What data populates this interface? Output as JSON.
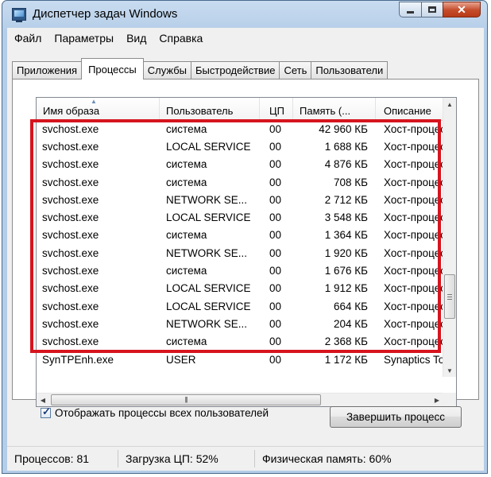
{
  "window": {
    "title": "Диспетчер задач Windows"
  },
  "menu": [
    "Файл",
    "Параметры",
    "Вид",
    "Справка"
  ],
  "tabs": [
    {
      "label": "Приложения",
      "active": false
    },
    {
      "label": "Процессы",
      "active": true
    },
    {
      "label": "Службы",
      "active": false
    },
    {
      "label": "Быстродействие",
      "active": false
    },
    {
      "label": "Сеть",
      "active": false
    },
    {
      "label": "Пользователи",
      "active": false
    }
  ],
  "table": {
    "columns": [
      "Имя образа",
      "Пользователь",
      "ЦП",
      "Память (...",
      "Описание"
    ],
    "rows": [
      [
        "svchost.exe",
        "система",
        "00",
        "42 960 КБ",
        "Хост-процесс"
      ],
      [
        "svchost.exe",
        "LOCAL SERVICE",
        "00",
        "1 688 КБ",
        "Хост-процесс"
      ],
      [
        "svchost.exe",
        "система",
        "00",
        "4 876 КБ",
        "Хост-процесс"
      ],
      [
        "svchost.exe",
        "система",
        "00",
        "708 КБ",
        "Хост-процесс"
      ],
      [
        "svchost.exe",
        "NETWORK SE...",
        "00",
        "2 712 КБ",
        "Хост-процесс"
      ],
      [
        "svchost.exe",
        "LOCAL SERVICE",
        "00",
        "3 548 КБ",
        "Хост-процесс"
      ],
      [
        "svchost.exe",
        "система",
        "00",
        "1 364 КБ",
        "Хост-процесс"
      ],
      [
        "svchost.exe",
        "NETWORK SE...",
        "00",
        "1 920 КБ",
        "Хост-процесс"
      ],
      [
        "svchost.exe",
        "система",
        "00",
        "1 676 КБ",
        "Хост-процесс"
      ],
      [
        "svchost.exe",
        "LOCAL SERVICE",
        "00",
        "1 912 КБ",
        "Хост-процесс"
      ],
      [
        "svchost.exe",
        "LOCAL SERVICE",
        "00",
        "664 КБ",
        "Хост-процесс"
      ],
      [
        "svchost.exe",
        "NETWORK SE...",
        "00",
        "204 КБ",
        "Хост-процесс"
      ],
      [
        "svchost.exe",
        "система",
        "00",
        "2 368 КБ",
        "Хост-процесс"
      ],
      [
        "SynTPEnh.exe",
        "USER",
        "00",
        "1 172 КБ",
        "Synaptics TouchPad"
      ]
    ]
  },
  "show_all_users": {
    "label": "Отображать процессы всех пользователей",
    "checked": true
  },
  "end_process_button": "Завершить процесс",
  "status": {
    "processes": "Процессов: 81",
    "cpu_load": "Загрузка ЦП: 52%",
    "physical_memory": "Физическая память: 60%"
  },
  "colors": {
    "highlight": "#d6141e",
    "titlebar": "#b4cde8",
    "close_button": "#c44b2a"
  }
}
